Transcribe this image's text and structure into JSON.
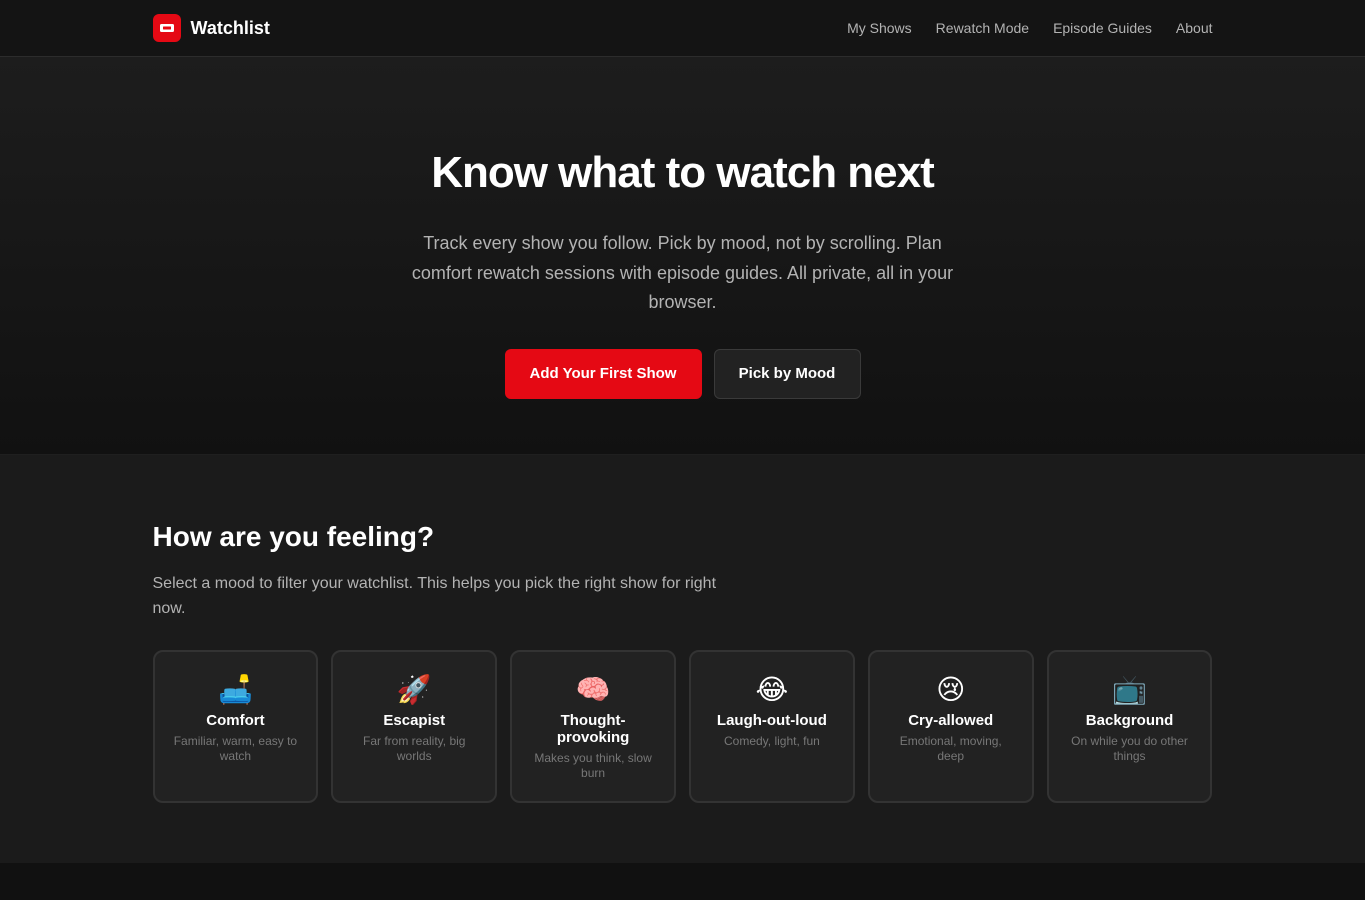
{
  "brand": {
    "name": "Watchlist",
    "accent": "#e50914"
  },
  "nav": {
    "links": [
      {
        "label": "My Shows"
      },
      {
        "label": "Rewatch Mode"
      },
      {
        "label": "Episode Guides"
      },
      {
        "label": "About"
      }
    ]
  },
  "hero": {
    "title": "Know what to watch next",
    "subtitle": "Track every show you follow. Pick by mood, not by scrolling. Plan comfort rewatch sessions with episode guides. All private, all in your browser.",
    "primary_cta": "Add Your First Show",
    "secondary_cta": "Pick by Mood"
  },
  "mood": {
    "title": "How are you feeling?",
    "subtitle": "Select a mood to filter your watchlist. This helps you pick the right show for right now.",
    "cards": [
      {
        "icon": "🛋️",
        "icon_name": "couch-lamp-icon",
        "label": "Comfort",
        "desc": "Familiar, warm, easy to watch"
      },
      {
        "icon": "🚀",
        "icon_name": "rocket-icon",
        "label": "Escapist",
        "desc": "Far from reality, big worlds"
      },
      {
        "icon": "🧠",
        "icon_name": "brain-icon",
        "label": "Thought-provoking",
        "desc": "Makes you think, slow burn"
      },
      {
        "icon": "😂",
        "icon_name": "laughing-face-icon",
        "label": "Laugh-out-loud",
        "desc": "Comedy, light, fun"
      },
      {
        "icon": "😢",
        "icon_name": "crying-face-icon",
        "label": "Cry-allowed",
        "desc": "Emotional, moving, deep"
      },
      {
        "icon": "📺",
        "icon_name": "television-icon",
        "label": "Background",
        "desc": "On while you do other things"
      }
    ]
  }
}
